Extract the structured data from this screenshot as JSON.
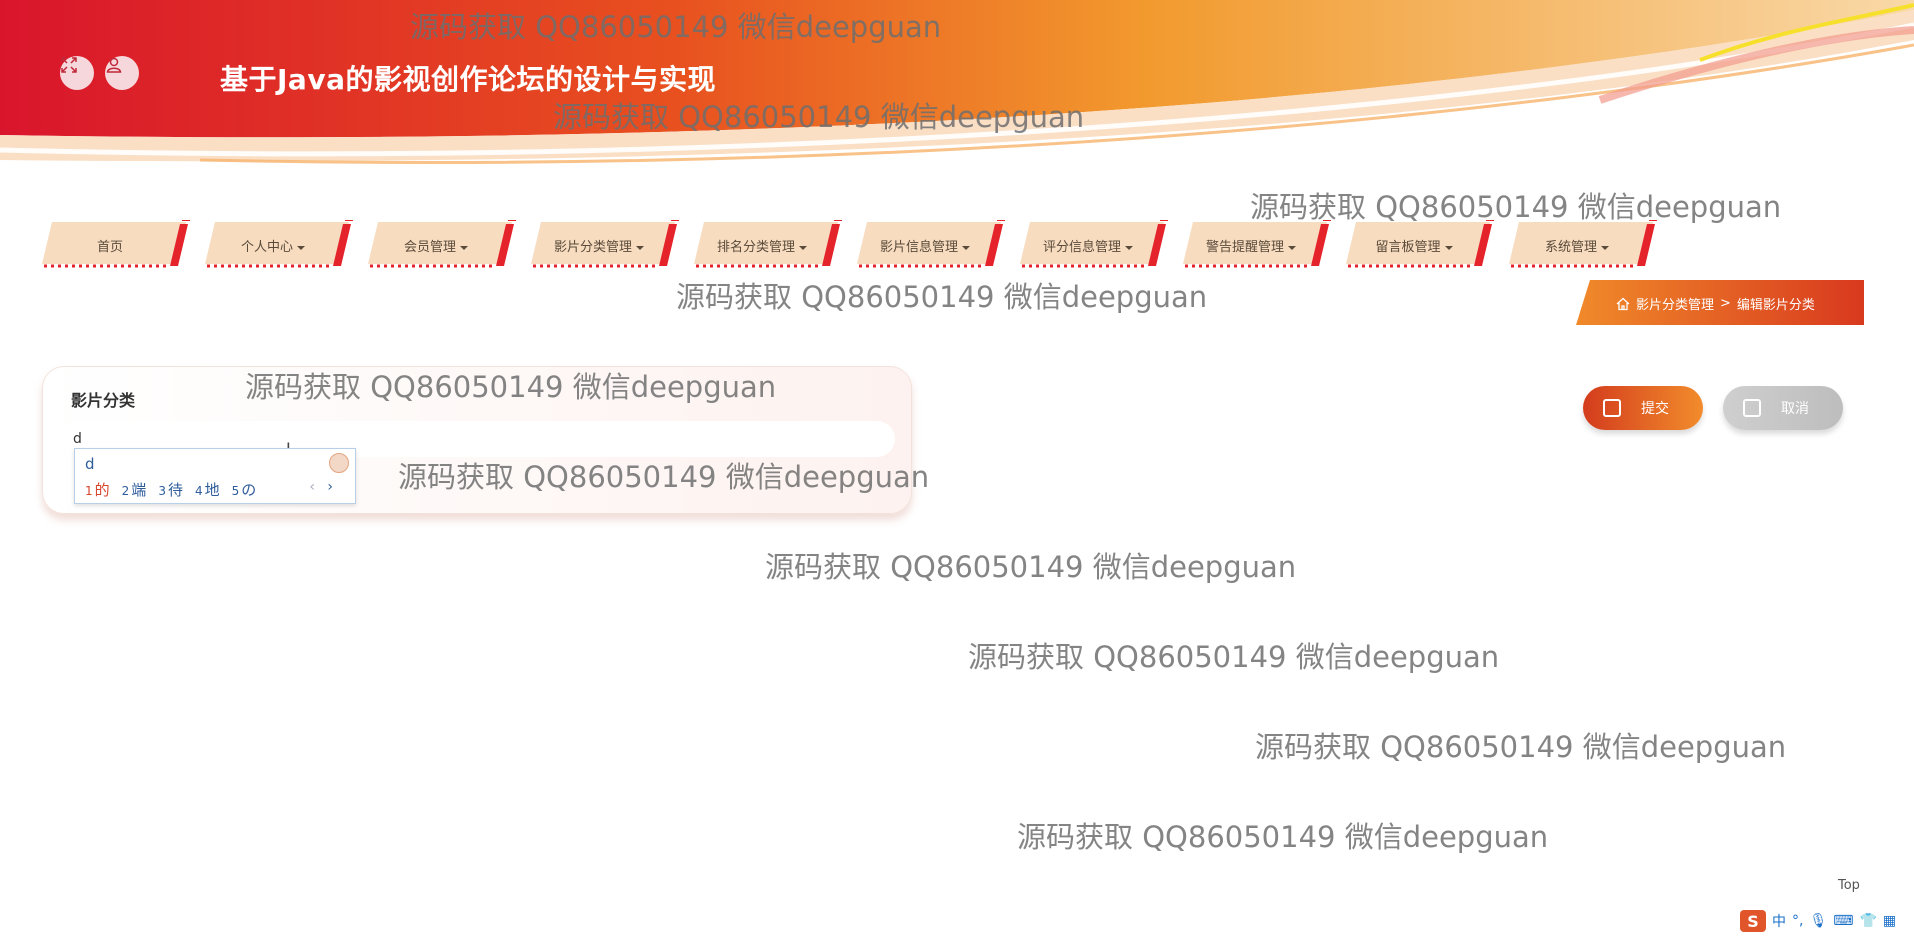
{
  "header": {
    "title": "基于Java的影视创作论坛的设计与实现",
    "fullscreen_icon": "expand-icon",
    "user_icon": "user-icon"
  },
  "nav": {
    "items": [
      {
        "label": "首页",
        "dropdown": false
      },
      {
        "label": "个人中心",
        "dropdown": true
      },
      {
        "label": "会员管理",
        "dropdown": true
      },
      {
        "label": "影片分类管理",
        "dropdown": true
      },
      {
        "label": "排名分类管理",
        "dropdown": true
      },
      {
        "label": "影片信息管理",
        "dropdown": true
      },
      {
        "label": "评分信息管理",
        "dropdown": true
      },
      {
        "label": "警告提醒管理",
        "dropdown": true
      },
      {
        "label": "留言板管理",
        "dropdown": true
      },
      {
        "label": "系统管理",
        "dropdown": true
      }
    ]
  },
  "breadcrumb": {
    "icon": "home-icon",
    "section": "影片分类管理",
    "separator": ">",
    "page": "编辑影片分类"
  },
  "form": {
    "field_label": "影片分类",
    "field_value": "d"
  },
  "ime": {
    "composition": "d",
    "candidates": [
      {
        "num": "1",
        "text": "的"
      },
      {
        "num": "2",
        "text": "端"
      },
      {
        "num": "3",
        "text": "待"
      },
      {
        "num": "4",
        "text": "地"
      },
      {
        "num": "5",
        "text": "の"
      }
    ],
    "prev": "‹",
    "next": "›"
  },
  "buttons": {
    "submit": "提交",
    "cancel": "取消"
  },
  "watermark": "源码获取 QQ86050149 微信deepguan",
  "top_link": "Top",
  "tray": {
    "logo": "S",
    "lang": "中",
    "punct": "°,"
  },
  "colors": {
    "accent_red": "#d9342b",
    "accent_orange": "#f28c2c",
    "nav_bg": "#f7dcc0"
  }
}
